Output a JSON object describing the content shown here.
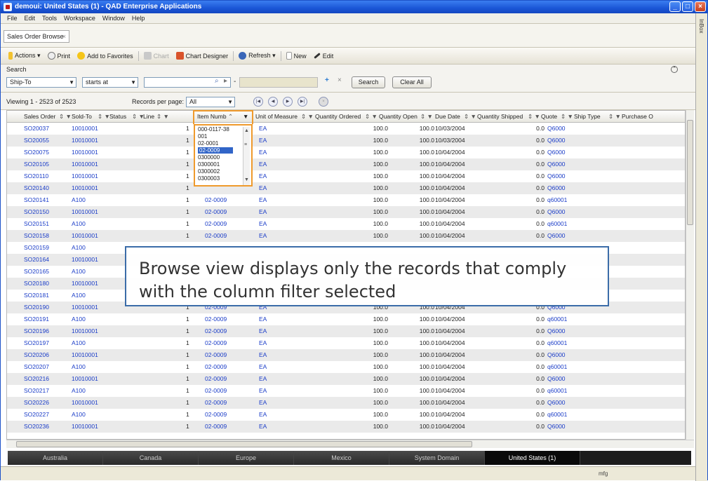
{
  "window": {
    "title": "demoui: United States (1) - QAD Enterprise Applications"
  },
  "menu": [
    "File",
    "Edit",
    "Tools",
    "Workspace",
    "Window",
    "Help"
  ],
  "inbox_label": "InBox",
  "doc_tab": {
    "label": "Sales Order Browse",
    "close": "×"
  },
  "toolbar": {
    "actions": "Actions ▾",
    "print": "Print",
    "favorites": "Add to Favorites",
    "chart": "Chart",
    "chart_designer": "Chart Designer",
    "refresh": "Refresh ▾",
    "new": "New",
    "edit": "Edit"
  },
  "search": {
    "label": "Search",
    "field": "Ship-To",
    "operator": "starts at",
    "value": "",
    "dash": "-",
    "plus": "+",
    "x": "×",
    "search_btn": "Search",
    "clear_btn": "Clear All"
  },
  "nav": {
    "viewing": "Viewing 1 - 2523 of 2523",
    "rpp_label": "Records per page:",
    "rpp_value": "All"
  },
  "columns": [
    "Sales Order",
    "Sold-To",
    "Status",
    "Line",
    "Item Numb",
    "Unit of Measure",
    "Quantity Ordered",
    "Quantity Open",
    "Due Date",
    "Quantity Shipped",
    "Quote",
    "Ship Type",
    "Purchase O"
  ],
  "rows": [
    [
      "SO20037",
      "10010001",
      "1",
      "",
      "EA",
      "100.0",
      "100.0",
      "10/03/2004",
      "0.0",
      "Q6000"
    ],
    [
      "SO20055",
      "10010001",
      "1",
      "",
      "EA",
      "100.0",
      "100.0",
      "10/03/2004",
      "0.0",
      "Q6000"
    ],
    [
      "SO20075",
      "10010001",
      "1",
      "",
      "EA",
      "100.0",
      "100.0",
      "10/04/2004",
      "0.0",
      "Q6000"
    ],
    [
      "SO20105",
      "10010001",
      "1",
      "",
      "EA",
      "100.0",
      "100.0",
      "10/04/2004",
      "0.0",
      "Q6000"
    ],
    [
      "SO20110",
      "10010001",
      "1",
      "",
      "EA",
      "100.0",
      "100.0",
      "10/04/2004",
      "0.0",
      "Q6000"
    ],
    [
      "SO20140",
      "10010001",
      "1",
      "",
      "EA",
      "100.0",
      "100.0",
      "10/04/2004",
      "0.0",
      "Q6000"
    ],
    [
      "SO20141",
      "A100",
      "1",
      "02-0009",
      "EA",
      "100.0",
      "100.0",
      "10/04/2004",
      "0.0",
      "q60001"
    ],
    [
      "SO20150",
      "10010001",
      "1",
      "02-0009",
      "EA",
      "100.0",
      "100.0",
      "10/04/2004",
      "0.0",
      "Q6000"
    ],
    [
      "SO20151",
      "A100",
      "1",
      "02-0009",
      "EA",
      "100.0",
      "100.0",
      "10/04/2004",
      "0.0",
      "q60001"
    ],
    [
      "SO20158",
      "10010001",
      "1",
      "02-0009",
      "EA",
      "100.0",
      "100.0",
      "10/04/2004",
      "0.0",
      "Q6000"
    ],
    [
      "SO20159",
      "A100",
      "",
      "",
      "",
      "",
      "",
      "",
      "",
      ""
    ],
    [
      "SO20164",
      "10010001",
      "",
      "",
      "",
      "",
      "",
      "",
      "",
      ""
    ],
    [
      "SO20165",
      "A100",
      "",
      "",
      "",
      "",
      "",
      "",
      "",
      ""
    ],
    [
      "SO20180",
      "10010001",
      "",
      "",
      "",
      "",
      "",
      "",
      "",
      ""
    ],
    [
      "SO20181",
      "A100",
      "",
      "",
      "",
      "",
      "",
      "",
      "",
      ""
    ],
    [
      "SO20190",
      "10010001",
      "1",
      "02-0009",
      "EA",
      "100.0",
      "100.0",
      "10/04/2004",
      "0.0",
      "Q6000"
    ],
    [
      "SO20191",
      "A100",
      "1",
      "02-0009",
      "EA",
      "100.0",
      "100.0",
      "10/04/2004",
      "0.0",
      "q60001"
    ],
    [
      "SO20196",
      "10010001",
      "1",
      "02-0009",
      "EA",
      "100.0",
      "100.0",
      "10/04/2004",
      "0.0",
      "Q6000"
    ],
    [
      "SO20197",
      "A100",
      "1",
      "02-0009",
      "EA",
      "100.0",
      "100.0",
      "10/04/2004",
      "0.0",
      "q60001"
    ],
    [
      "SO20206",
      "10010001",
      "1",
      "02-0009",
      "EA",
      "100.0",
      "100.0",
      "10/04/2004",
      "0.0",
      "Q6000"
    ],
    [
      "SO20207",
      "A100",
      "1",
      "02-0009",
      "EA",
      "100.0",
      "100.0",
      "10/04/2004",
      "0.0",
      "q60001"
    ],
    [
      "SO20216",
      "10010001",
      "1",
      "02-0009",
      "EA",
      "100.0",
      "100.0",
      "10/04/2004",
      "0.0",
      "Q6000"
    ],
    [
      "SO20217",
      "A100",
      "1",
      "02-0009",
      "EA",
      "100.0",
      "100.0",
      "10/04/2004",
      "0.0",
      "q60001"
    ],
    [
      "SO20226",
      "10010001",
      "1",
      "02-0009",
      "EA",
      "100.0",
      "100.0",
      "10/04/2004",
      "0.0",
      "Q6000"
    ],
    [
      "SO20227",
      "A100",
      "1",
      "02-0009",
      "EA",
      "100.0",
      "100.0",
      "10/04/2004",
      "0.0",
      "q60001"
    ],
    [
      "SO20236",
      "10010001",
      "1",
      "02-0009",
      "EA",
      "100.0",
      "100.0",
      "10/04/2004",
      "0.0",
      "Q6000"
    ]
  ],
  "filter_list": [
    "000-0117-38",
    "001",
    "02-0001",
    "02-0009",
    "0300000",
    "0300001",
    "0300002",
    "0300003"
  ],
  "filter_selected": "02-0009",
  "callout": "Browse view displays only the records that comply with the column filter selected",
  "domains": [
    "Australia",
    "Canada",
    "Europe",
    "Mexico",
    "System Domain",
    "United States (1)"
  ],
  "active_domain": "United States (1)",
  "status": "mfg"
}
